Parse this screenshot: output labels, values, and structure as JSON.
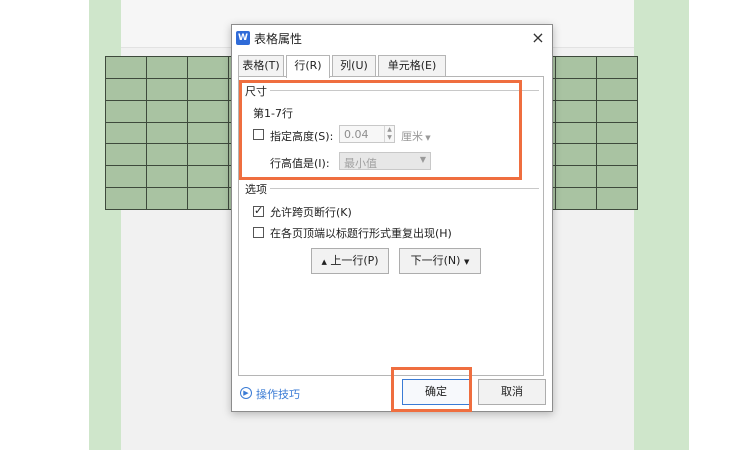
{
  "dialog": {
    "title": "表格属性",
    "app_icon": "W",
    "close_glyph": "×"
  },
  "tabs": [
    {
      "label": "表格(T)",
      "active": false
    },
    {
      "label": "行(R)",
      "active": true
    },
    {
      "label": "列(U)",
      "active": false
    },
    {
      "label": "单元格(E)",
      "active": false
    }
  ],
  "size_group": {
    "title": "尺寸",
    "rows_label": "第1-7行",
    "specify_height_label": "指定高度(S):",
    "specify_height_checked": false,
    "height_value": "0.04",
    "unit": "厘米",
    "row_height_is_label": "行高值是(I):",
    "row_height_is_value": "最小值"
  },
  "options_group": {
    "title": "选项",
    "allow_break_label": "允许跨页断行(K)",
    "allow_break_checked": true,
    "repeat_header_label": "在各页顶端以标题行形式重复出现(H)",
    "repeat_header_checked": false
  },
  "nav": {
    "prev_row": "上一行(P)",
    "next_row": "下一行(N)",
    "prev_glyph": "▲",
    "next_glyph": "▼"
  },
  "footer": {
    "help_label": "操作技巧",
    "ok": "确定",
    "cancel": "取消"
  },
  "colors": {
    "highlight": "#ef6e3f",
    "table_fill": "#a9c3a2",
    "doc_green": "#cfe6cb",
    "accent": "#3a7bd5"
  },
  "doc_table": {
    "rows": 7,
    "cols": 13
  }
}
